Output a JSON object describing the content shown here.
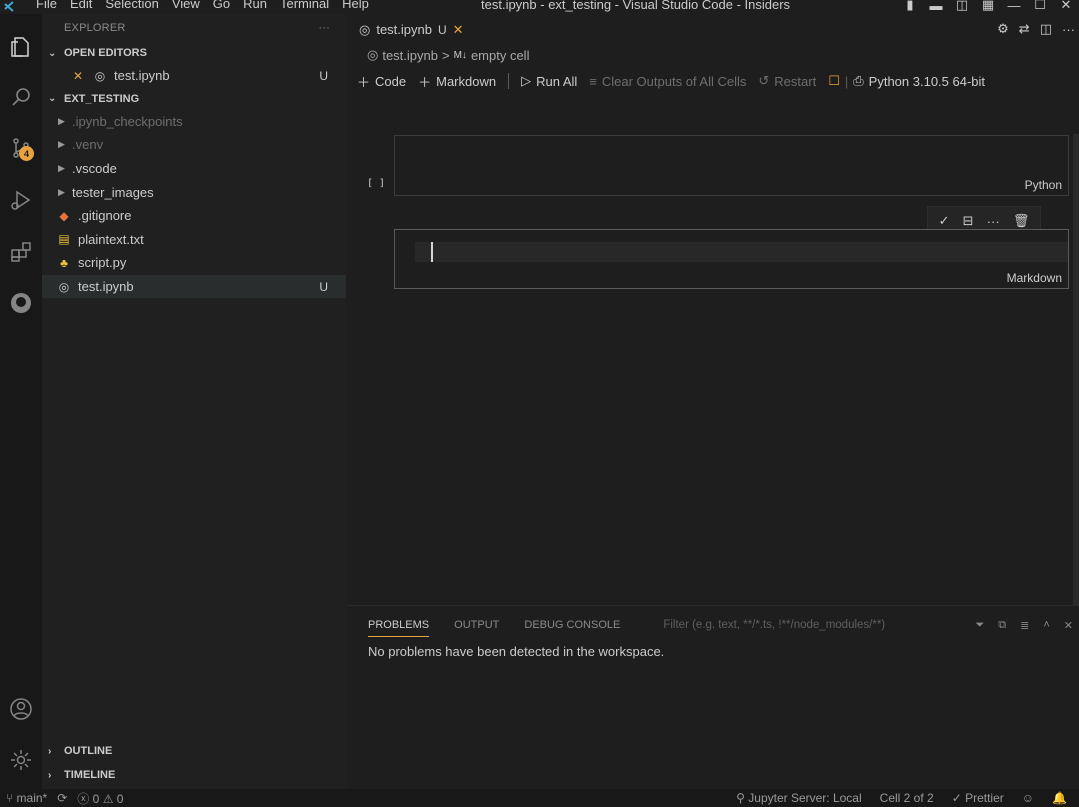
{
  "titlebar": {
    "menu": [
      "File",
      "Edit",
      "Selection",
      "View",
      "Go",
      "Run",
      "Terminal",
      "Help"
    ],
    "title": "test.ipynb - ext_testing - Visual Studio Code - Insiders"
  },
  "activity": {
    "scm_badge": "4"
  },
  "sidebar": {
    "header": "EXPLORER",
    "more": "···",
    "open_editors": {
      "label": "OPEN EDITORS",
      "items": [
        {
          "name": "test.ipynb",
          "status": "U"
        }
      ]
    },
    "folder": {
      "label": "EXT_TESTING",
      "items": [
        {
          "name": ".ipynb_checkpoints",
          "status": ""
        },
        {
          "name": ".venv",
          "status": ""
        },
        {
          "name": ".vscode",
          "status": ""
        },
        {
          "name": "tester_images",
          "status": ""
        },
        {
          "name": ".gitignore",
          "status": ""
        },
        {
          "name": "plaintext.txt",
          "status": ""
        },
        {
          "name": "script.py",
          "status": ""
        },
        {
          "name": "test.ipynb",
          "status": "U"
        }
      ]
    },
    "outline": "OUTLINE",
    "timeline": "TIMELINE"
  },
  "editor": {
    "tab": {
      "name": "test.ipynb",
      "status": "U"
    },
    "breadcrumb": {
      "file": "test.ipynb",
      "sep": ">",
      "cell_badge": "M↓",
      "cell": "empty cell"
    },
    "toolbar": {
      "code": "Code",
      "markdown": "Markdown",
      "run_all": "Run All",
      "clear_outputs": "Clear Outputs of All Cells",
      "restart": "Restart",
      "kernel": "Python 3.10.5 64-bit"
    },
    "cells": [
      {
        "exec_count": "[ ]",
        "language": "Python"
      },
      {
        "language": "Markdown"
      }
    ]
  },
  "panel": {
    "tabs": [
      "PROBLEMS",
      "OUTPUT",
      "DEBUG CONSOLE"
    ],
    "filter_placeholder": "Filter (e.g. text, **/*.ts, !**/node_modules/**)",
    "message": "No problems have been detected in the workspace."
  },
  "statusbar": {
    "branch": "main*",
    "errors": "0",
    "warnings": "0",
    "jupyter": "Jupyter Server: Local",
    "cell_pos": "Cell 2 of 2",
    "prettier": "Prettier"
  },
  "colors": {
    "accent_orange": "#e8a33d",
    "background": "#1e1e1e",
    "sidebar": "#202020"
  }
}
